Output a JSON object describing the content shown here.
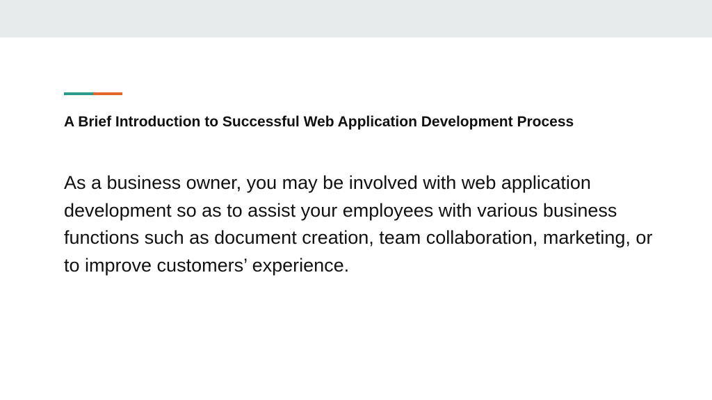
{
  "slide": {
    "title": "A Brief Introduction to Successful Web Application Development Process",
    "body": "As a business owner, you may be involved with web application development so as to assist your employees with various business functions such as document creation, team collaboration, marketing, or to improve customers’ experience."
  },
  "colors": {
    "top_band": "#e8ebeb",
    "accent_teal": "#2a9d8f",
    "accent_orange": "#e4672a",
    "text": "#111111"
  }
}
